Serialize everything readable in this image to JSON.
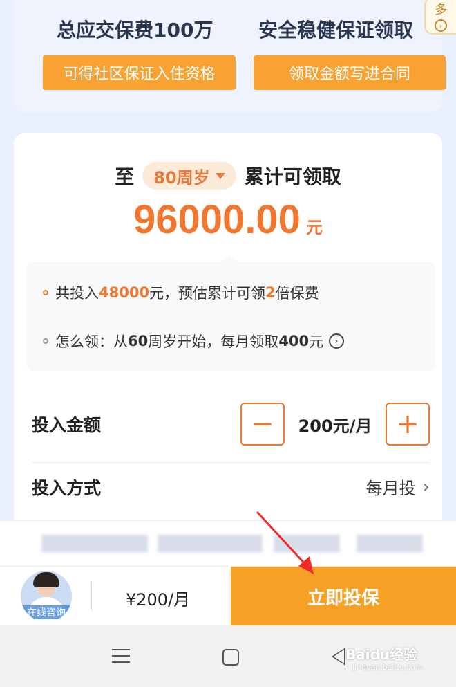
{
  "banner": {
    "left_heading": "总应交保费100万",
    "right_heading": "安全稳健保证领取",
    "left_tag": "可得社区保证入住资格",
    "right_tag": "领取金额写进合同",
    "more_tab": "多"
  },
  "summary": {
    "prefix": "至",
    "age_selector": "80周岁",
    "suffix": "累计可领取",
    "amount": "96000.00",
    "amount_unit": "元"
  },
  "info": {
    "line1": {
      "a": "共投入",
      "b": "48000",
      "c": "元，预估累计可领",
      "d": "2",
      "e": "倍保费"
    },
    "line2": {
      "a": "怎么领：从",
      "b": "60",
      "c": "周岁开始，每月领取",
      "d": "400",
      "e": "元"
    }
  },
  "form": {
    "amount_label": "投入金额",
    "amount_value": "200元/月",
    "decrease_symbol": "−",
    "increase_symbol": "+",
    "method_label": "投入方式",
    "method_value": "每月投"
  },
  "action_bar": {
    "consult_label": "在线咨询",
    "price": "¥200/月",
    "buy_label": "立即投保"
  },
  "watermark": {
    "brand": "Baidu经验",
    "url": "jingyan.baidu.com"
  },
  "colors": {
    "accent": "#f0772f",
    "button": "#f7a026",
    "tag": "#f7a233"
  }
}
